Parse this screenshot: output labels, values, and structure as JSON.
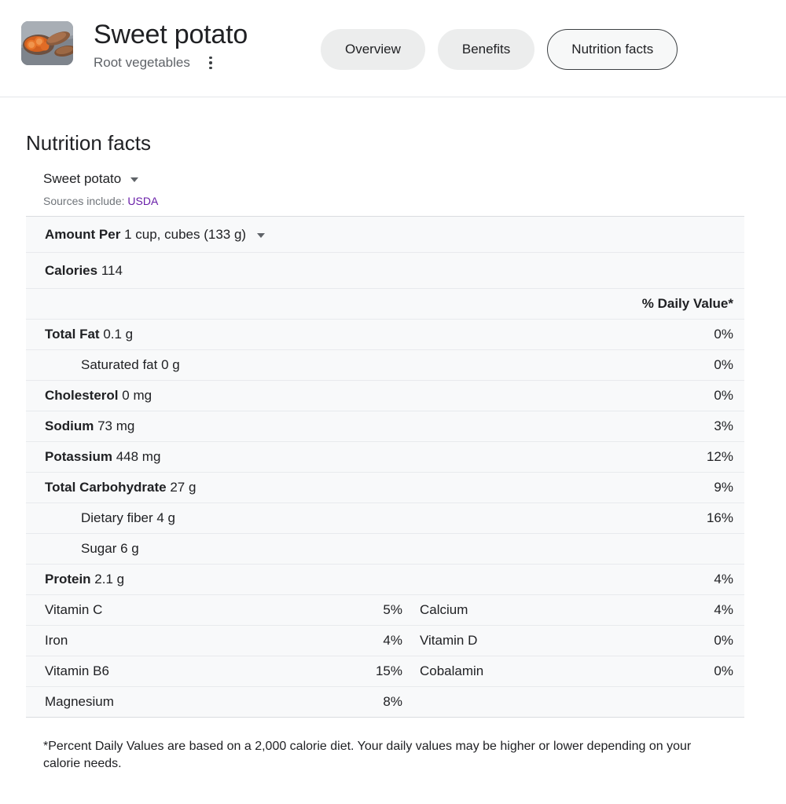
{
  "header": {
    "thumbnail_alt": "sweet-potato-photo",
    "title": "Sweet potato",
    "subtitle": "Root vegetables",
    "menu_icon": "kebab-menu-icon",
    "tabs": [
      {
        "label": "Overview",
        "selected": false
      },
      {
        "label": "Benefits",
        "selected": false
      },
      {
        "label": "Nutrition facts",
        "selected": true
      }
    ]
  },
  "main": {
    "page_title": "Nutrition facts",
    "food_selector": {
      "value": "Sweet potato",
      "caret_icon": "chevron-down-icon"
    },
    "sources": {
      "prefix": "Sources include:",
      "link_text": "USDA",
      "link_color": "#681da8"
    },
    "serving": {
      "label": "Amount Per",
      "value": "1 cup, cubes (133 g)",
      "caret_icon": "chevron-down-icon"
    },
    "calories": {
      "label": "Calories",
      "value": "114"
    },
    "daily_value_header": "% Daily Value*",
    "nutrients": [
      {
        "name": "Total Fat",
        "amount": "0.1 g",
        "dv": "0%",
        "bold": true,
        "indent": false
      },
      {
        "name": "Saturated fat",
        "amount": "0 g",
        "dv": "0%",
        "bold": false,
        "indent": true
      },
      {
        "name": "Cholesterol",
        "amount": "0 mg",
        "dv": "0%",
        "bold": true,
        "indent": false
      },
      {
        "name": "Sodium",
        "amount": "73 mg",
        "dv": "3%",
        "bold": true,
        "indent": false
      },
      {
        "name": "Potassium",
        "amount": "448 mg",
        "dv": "12%",
        "bold": true,
        "indent": false
      },
      {
        "name": "Total Carbohydrate",
        "amount": "27 g",
        "dv": "9%",
        "bold": true,
        "indent": false
      },
      {
        "name": "Dietary fiber",
        "amount": "4 g",
        "dv": "16%",
        "bold": false,
        "indent": true
      },
      {
        "name": "Sugar",
        "amount": "6 g",
        "dv": "",
        "bold": false,
        "indent": true
      },
      {
        "name": "Protein",
        "amount": "2.1 g",
        "dv": "4%",
        "bold": true,
        "indent": false
      }
    ],
    "micronutrients": [
      {
        "left_name": "Vitamin C",
        "left_pct": "5%",
        "right_name": "Calcium",
        "right_pct": "4%"
      },
      {
        "left_name": "Iron",
        "left_pct": "4%",
        "right_name": "Vitamin D",
        "right_pct": "0%"
      },
      {
        "left_name": "Vitamin B6",
        "left_pct": "15%",
        "right_name": "Cobalamin",
        "right_pct": "0%"
      },
      {
        "left_name": "Magnesium",
        "left_pct": "8%",
        "right_name": "",
        "right_pct": ""
      }
    ],
    "footnote": "*Percent Daily Values are based on a 2,000 calorie diet. Your daily values may be higher or lower depending on your calorie needs."
  }
}
